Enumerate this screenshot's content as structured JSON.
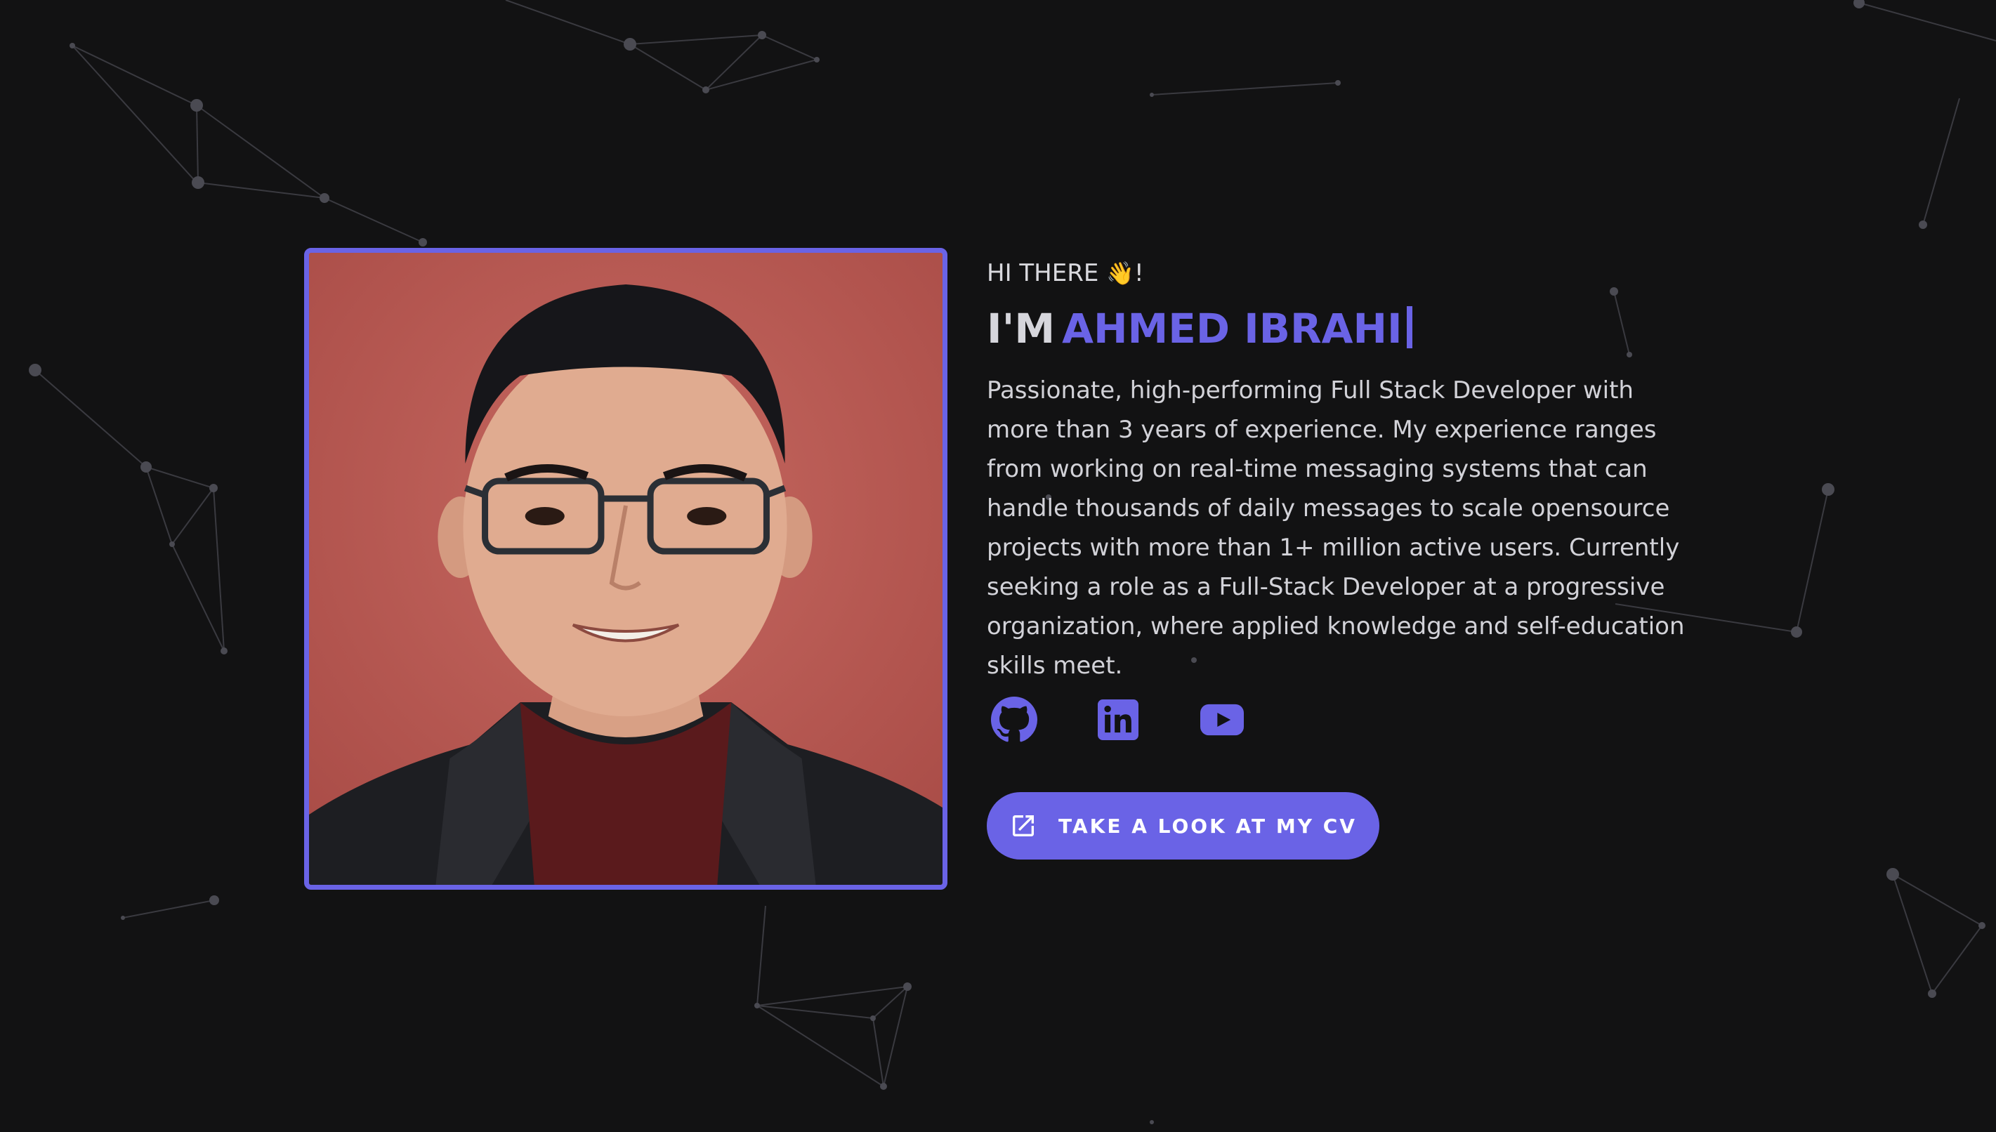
{
  "colors": {
    "background": "#121213",
    "accent": "#6a63e6",
    "text": "#d2d2d8",
    "particles": "#3a3a40"
  },
  "hero": {
    "greeting": "HI THERE",
    "greeting_emoji": "👋",
    "greeting_suffix": "!",
    "name_prefix": "I'M",
    "name_typed": "AHMED IBRAHI",
    "bio": "Passionate, high-performing Full Stack Developer with more than 3 years of experience. My experience ranges from working on real-time messaging systems that can handle thousands of daily messages to scale opensource projects with more than 1+ million active users. Currently seeking a role as a Full-Stack Developer at a progressive organization, where applied knowledge and self-education skills meet.",
    "photo": "profile-photo"
  },
  "socials": [
    {
      "icon": "github-icon"
    },
    {
      "icon": "linkedin-icon"
    },
    {
      "icon": "youtube-icon"
    }
  ],
  "cv_button": {
    "icon": "external-link-icon",
    "label": "TAKE A LOOK AT MY CV"
  }
}
